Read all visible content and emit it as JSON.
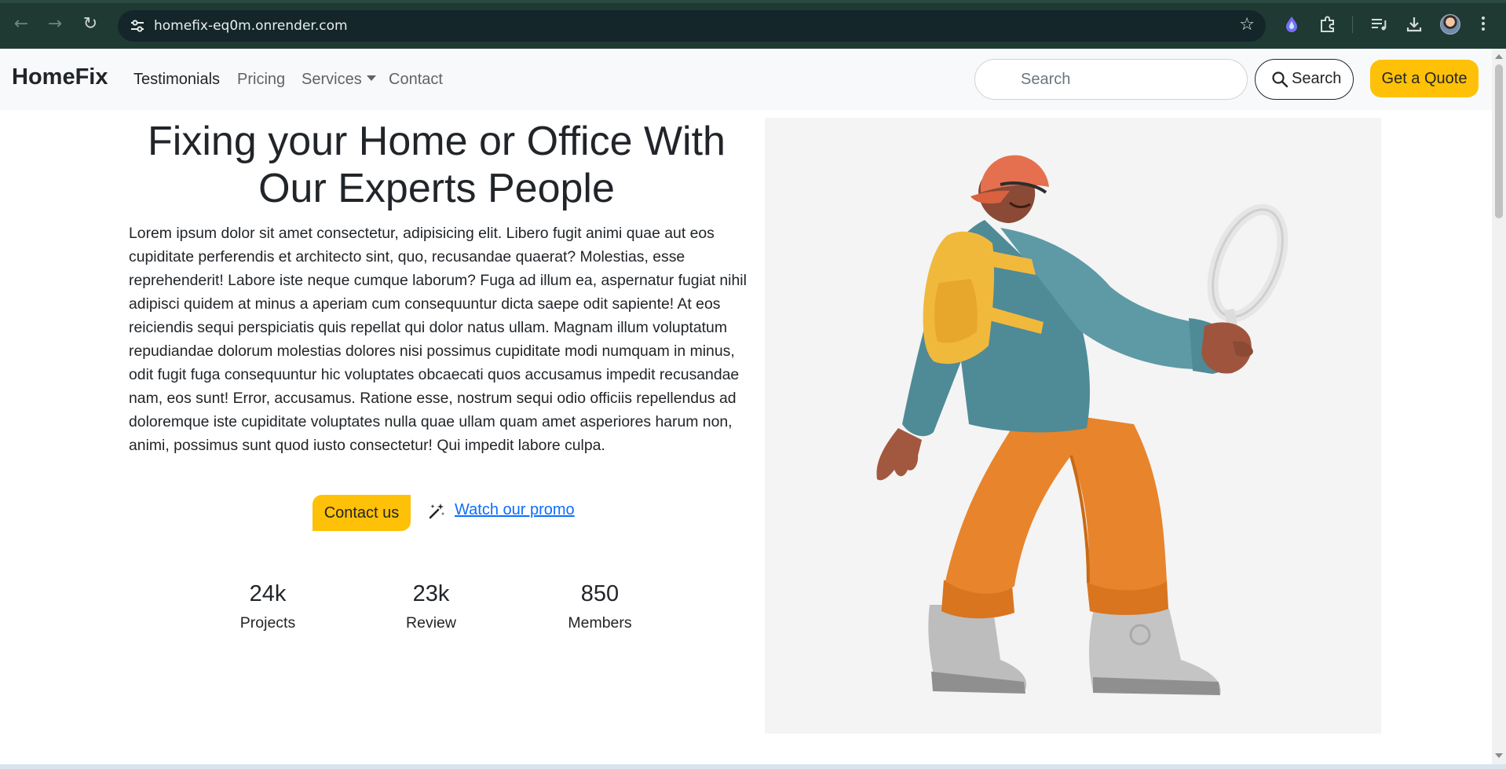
{
  "browser": {
    "url": "homefix-eq0m.onrender.com"
  },
  "nav": {
    "brand": "HomeFix",
    "links": [
      "Testimonials",
      "Pricing",
      "Services",
      "Contact"
    ],
    "search_placeholder": "Search",
    "search_button": "Search",
    "quote_button": "Get a Quote"
  },
  "hero": {
    "title": "Fixing your Home or Office With Our Experts People",
    "body": "Lorem ipsum dolor sit amet consectetur, adipisicing elit. Libero fugit animi quae aut eos cupiditate perferendis et architecto sint, quo, recusandae quaerat? Molestias, esse reprehenderit! Labore iste neque cumque laborum? Fuga ad illum ea, aspernatur fugiat nihil adipisci quidem at minus a aperiam cum consequuntur dicta saepe odit sapiente! At eos reiciendis sequi perspiciatis quis repellat qui dolor natus ullam. Magnam illum voluptatum repudiandae dolorum molestias dolores nisi possimus cupiditate modi numquam in minus, odit fugit fuga consequuntur hic voluptates obcaecati quos accusamus impedit recusandae nam, eos sunt! Error, accusamus. Ratione esse, nostrum sequi odio officiis repellendus ad doloremque iste cupiditate voluptates nulla quae ullam quam amet asperiores harum non, animi, possimus sunt quod iusto consectetur! Qui impedit labore culpa.",
    "contact_button": "Contact us",
    "promo_link": "Watch our promo",
    "stats": [
      {
        "value": "24k",
        "label": "Projects"
      },
      {
        "value": "23k",
        "label": "Review"
      },
      {
        "value": "850",
        "label": "Members"
      }
    ]
  },
  "colors": {
    "accent": "#ffc107",
    "link": "#0d6efd",
    "chrome_bg": "#1f3a33"
  },
  "icons": {
    "back": "back-arrow-icon",
    "forward": "forward-arrow-icon",
    "reload": "reload-icon",
    "site_settings": "tune-icon",
    "bookmark": "star-icon",
    "extension_1": "extension-drop-icon",
    "extensions": "puzzle-icon",
    "media": "media-queue-icon",
    "downloads": "download-icon",
    "menu": "kebab-menu-icon",
    "search": "magnifier-icon",
    "promo": "magic-wand-icon"
  }
}
